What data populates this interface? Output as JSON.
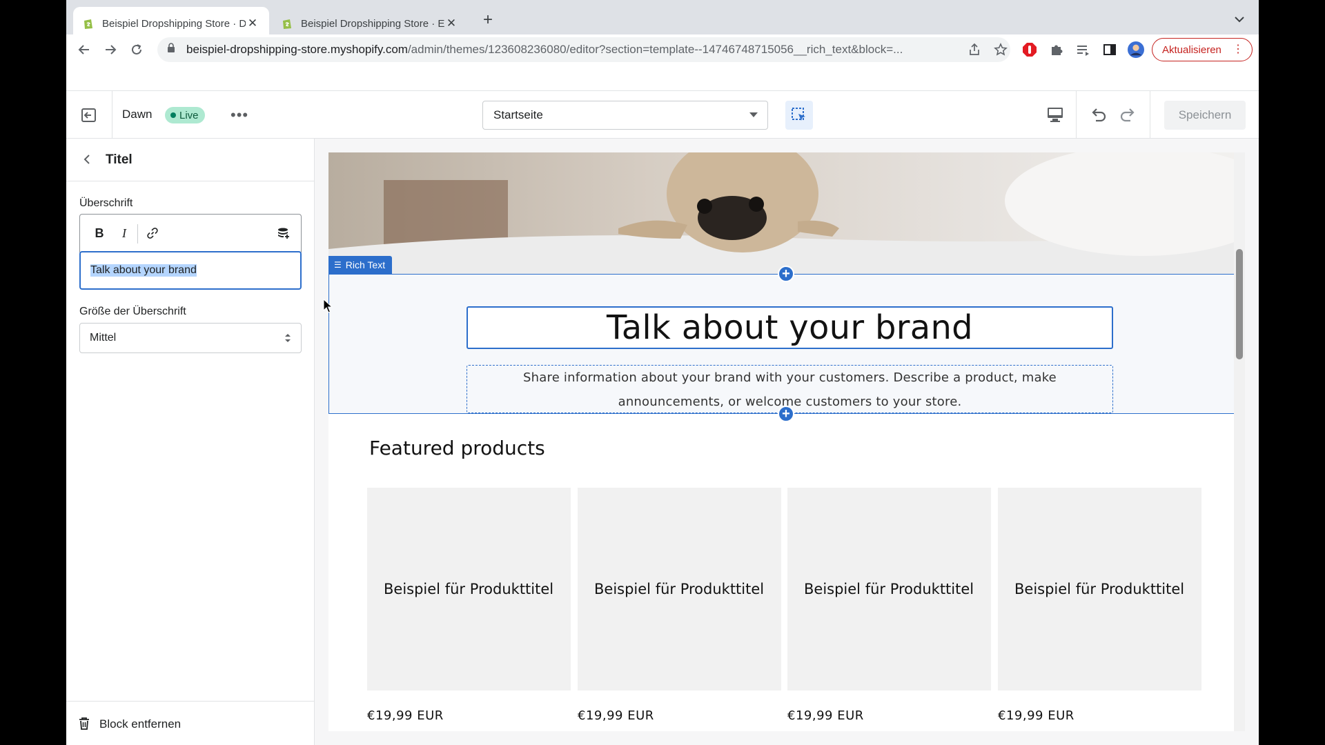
{
  "browser": {
    "tabs": [
      {
        "title": "Beispiel Dropshipping Store · D",
        "active": true
      },
      {
        "title": "Beispiel Dropshipping Store · E",
        "active": false
      }
    ],
    "url_host": "beispiel-dropshipping-store.myshopify.com",
    "url_path": "/admin/themes/123608236080/editor?section=template--14746748715056__rich_text&block=...",
    "update_label": "Aktualisieren"
  },
  "editor": {
    "theme_name": "Dawn",
    "live_label": "Live",
    "page_select_value": "Startseite",
    "save_label": "Speichern"
  },
  "sidebar": {
    "title": "Titel",
    "heading_label": "Überschrift",
    "heading_value": "Talk about your brand",
    "size_label": "Größe der Überschrift",
    "size_value": "Mittel",
    "remove_label": "Block entfernen"
  },
  "preview": {
    "section_tag": "Rich Text",
    "heading": "Talk about your brand",
    "text": "Share information about your brand with your customers. Describe a product, make announcements, or welcome customers to your store.",
    "featured_title": "Featured products",
    "products": [
      {
        "title": "Beispiel für Produkttitel",
        "price": "€19,99 EUR"
      },
      {
        "title": "Beispiel für Produkttitel",
        "price": "€19,99 EUR"
      },
      {
        "title": "Beispiel für Produkttitel",
        "price": "€19,99 EUR"
      },
      {
        "title": "Beispiel für Produkttitel",
        "price": "€19,99 EUR"
      }
    ]
  },
  "colors": {
    "accent": "#2c6ecb",
    "live_badge": "#aee9d1",
    "update_red": "#c5221f"
  }
}
